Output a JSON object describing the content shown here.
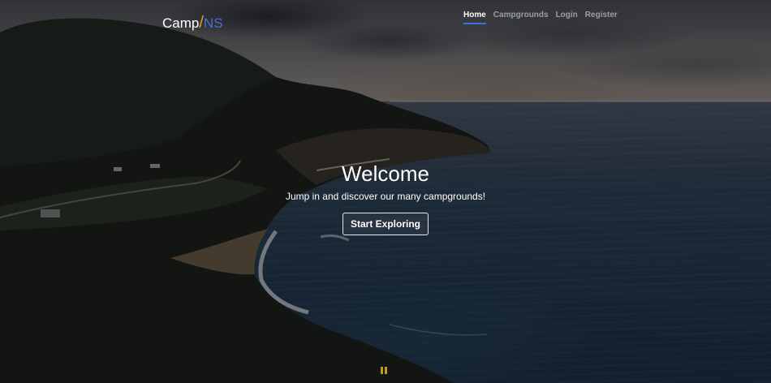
{
  "nav": {
    "brand": {
      "part1": "Camp",
      "slash": "/",
      "part2": "NS"
    },
    "links": [
      {
        "label": "Home",
        "active": true
      },
      {
        "label": "Campgrounds",
        "active": false
      },
      {
        "label": "Login",
        "active": false
      },
      {
        "label": "Register",
        "active": false
      }
    ]
  },
  "hero": {
    "title": "Welcome",
    "subtitle": "Jump in and discover our many campgrounds!",
    "button_label": "Start Exploring"
  },
  "background": {
    "image_subject": "coastal-cliffs-sea",
    "pause_icon": "pause-icon"
  },
  "colors": {
    "brand_slash": "#e3a21a",
    "brand_ns": "#4a6fd1",
    "active_underline": "#3f6fe0",
    "pause_icon": "#c79a1c"
  }
}
